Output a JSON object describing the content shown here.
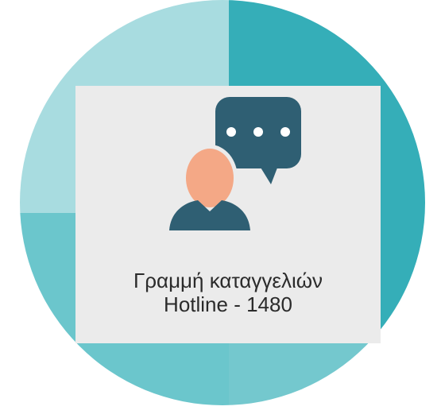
{
  "card": {
    "title_line1": "Γραμμή καταγγελιών",
    "title_line2": "Hotline - 1480"
  },
  "icon": {
    "name": "person-speech-bubble-icon"
  },
  "colors": {
    "circle_top_left": "#a8dce0",
    "circle_top_right": "#35aeb8",
    "circle_bottom_left": "#6bc6cc",
    "circle_bottom_right": "#74c8ce",
    "card_background": "#ebebeb",
    "icon_dark": "#2f5f73",
    "icon_skin": "#f4a886",
    "text": "#2b2b2b"
  }
}
